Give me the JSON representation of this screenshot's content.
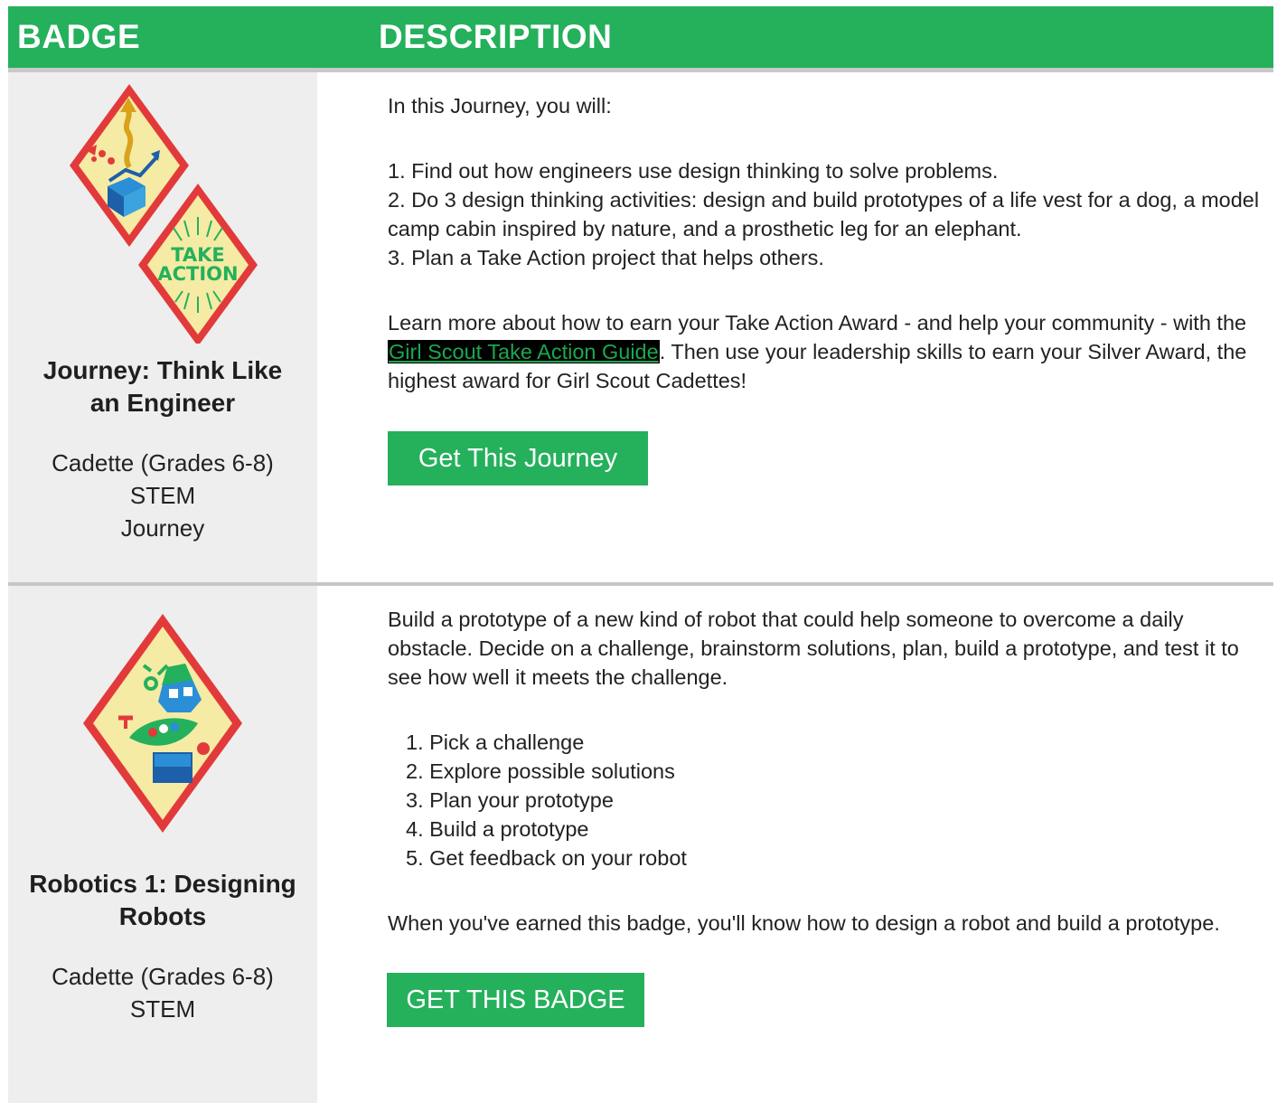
{
  "header": {
    "badge_label": "BADGE",
    "description_label": "DESCRIPTION"
  },
  "colors": {
    "brand_green": "#25b05c",
    "badge_column_bg": "#eeeeee",
    "link_bg": "#000000"
  },
  "rows": [
    {
      "badge": {
        "icons": [
          "think-like-engineer-badge-icon",
          "take-action-badge-icon"
        ],
        "take_action_text_1": "TAKE",
        "take_action_text_2": "ACTION",
        "title_line1": "Journey: Think Like",
        "title_line2": "an Engineer",
        "level": "Cadette (Grades 6-8)",
        "category": "STEM",
        "type": "Journey"
      },
      "description": {
        "intro": "In this Journey, you will:",
        "steps": [
          "1. Find out how engineers use design thinking to solve problems.",
          "2. Do 3 design thinking activities: design and build prototypes of a life vest for a dog, a model camp cabin inspired by nature, and a prosthetic leg for an elephant.",
          "3. Plan a Take Action project that helps others."
        ],
        "learn_more_before": "Learn more about how to earn your Take Action Award - and help your community - with the ",
        "link_text": "Girl Scout Take Action Guide",
        "learn_more_after": ".  Then use your leadership skills to earn your Silver Award, the highest award for Girl Scout Cadettes!",
        "button_label": "Get This Journey"
      }
    },
    {
      "badge": {
        "icons": [
          "robotics-badge-icon"
        ],
        "title_line1": "Robotics 1: Designing",
        "title_line2": "Robots",
        "level": "Cadette (Grades 6-8)",
        "category": "STEM"
      },
      "description": {
        "intro": "Build a prototype of a new kind of robot that could help someone to overcome a daily obstacle. Decide on a challenge, brainstorm solutions, plan, build a prototype, and test it to see how well it meets the challenge.",
        "steps": [
          "1. Pick a challenge",
          "2. Explore possible solutions",
          "3. Plan your prototype",
          "4. Build a prototype",
          "5. Get feedback on your robot"
        ],
        "outro": "When you've earned this badge, you'll know how to design a robot and build a prototype.",
        "button_label": "GET THIS BADGE"
      }
    }
  ]
}
